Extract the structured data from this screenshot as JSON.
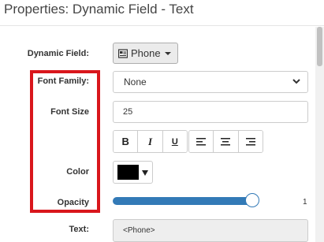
{
  "panel": {
    "title": "Properties: Dynamic Field - Text"
  },
  "labels": {
    "dynamic_field": "Dynamic Field:",
    "font_family": "Font Family:",
    "font_size": "Font Size",
    "color": "Color",
    "opacity": "Opacity",
    "text": "Text:"
  },
  "dynamic_field_button": {
    "label": "Phone",
    "icon": "id-card-icon"
  },
  "font_family_select": {
    "selected": "None"
  },
  "font_size_input": {
    "value": "25"
  },
  "style_buttons": [
    {
      "name": "bold-button",
      "glyph": "B"
    },
    {
      "name": "italic-button",
      "glyph": "I"
    },
    {
      "name": "underline-button",
      "glyph": "U"
    }
  ],
  "align_buttons": [
    {
      "name": "align-left-button",
      "icon": "align-left-icon"
    },
    {
      "name": "align-center-button",
      "icon": "align-center-icon"
    },
    {
      "name": "align-right-button",
      "icon": "align-right-icon"
    }
  ],
  "color_picker": {
    "value": "#000000"
  },
  "opacity_slider": {
    "value": "1",
    "fill_fraction": 0.94
  },
  "text_field": {
    "value": "<Phone>"
  },
  "colors": {
    "highlight_border": "#d9161c",
    "slider": "#337ab7"
  }
}
